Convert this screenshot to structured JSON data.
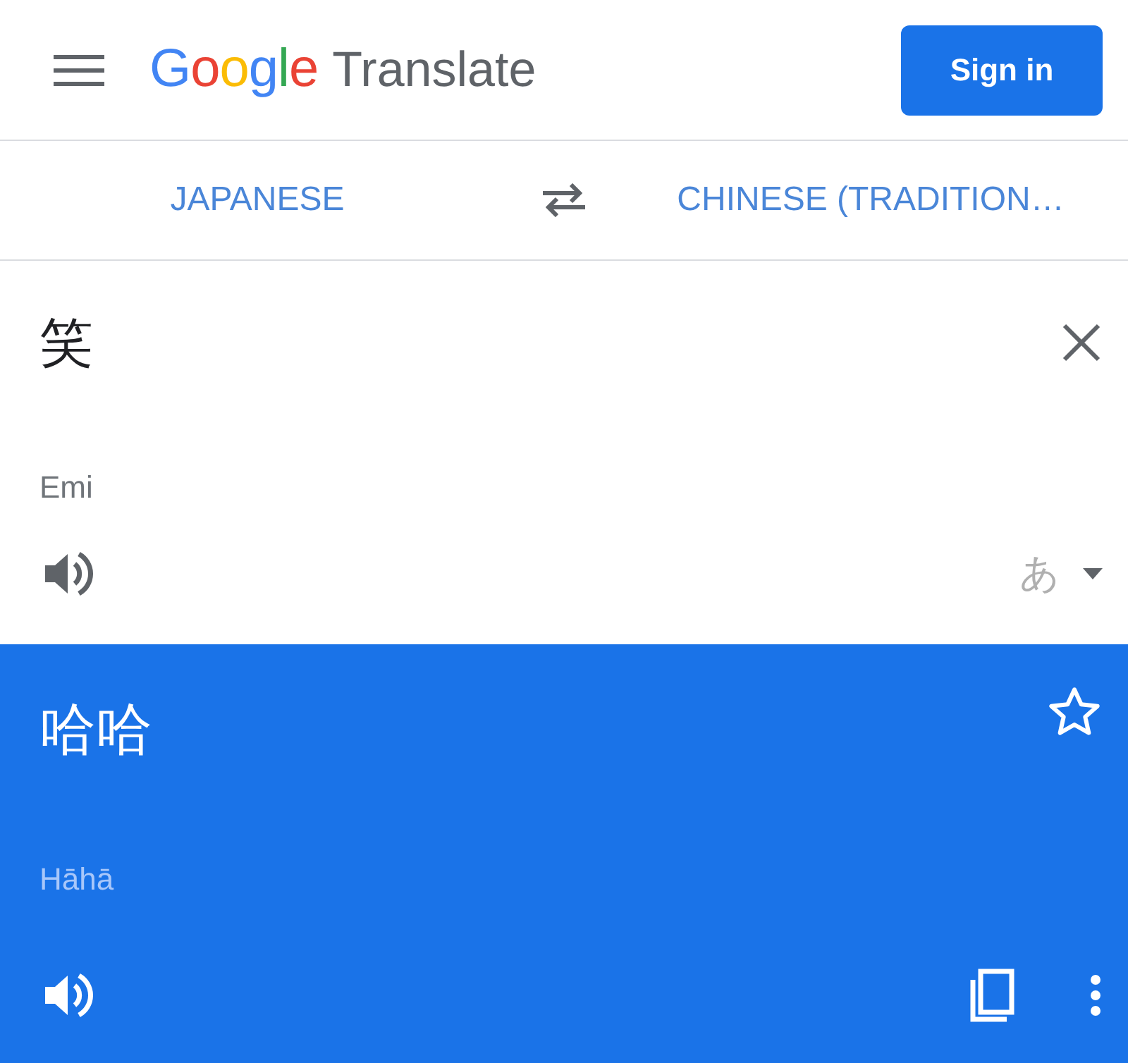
{
  "header": {
    "brand": "Google",
    "product": "Translate",
    "sign_in": "Sign in"
  },
  "languages": {
    "source": "JAPANESE",
    "target": "CHINESE (TRADITION…"
  },
  "input": {
    "value": "笑",
    "romanization": "Emi",
    "script_label": "あ"
  },
  "output": {
    "text": "哈哈",
    "romanization": "Hāhā",
    "starred": false
  }
}
